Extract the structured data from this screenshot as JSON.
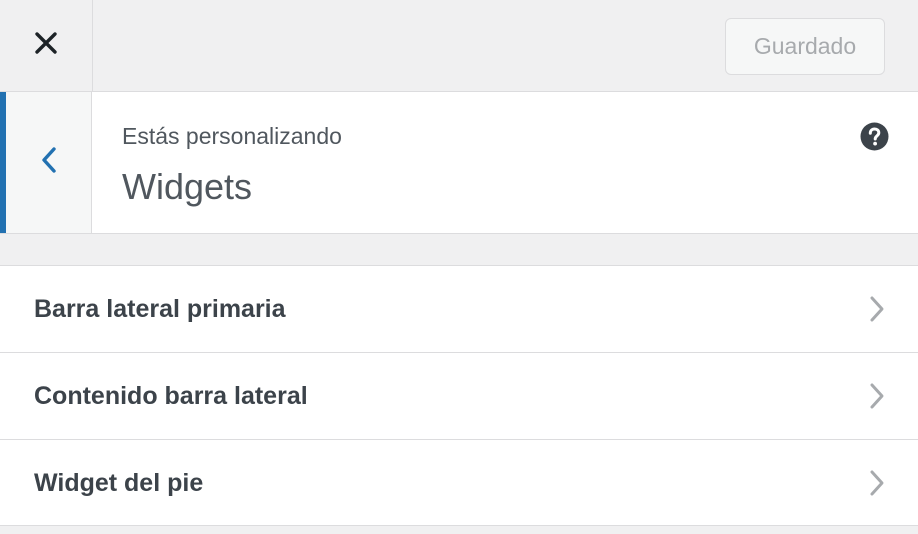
{
  "topbar": {
    "close_icon": "close-icon",
    "save_label": "Guardado"
  },
  "header": {
    "back_icon": "chevron-left-icon",
    "subtitle": "Estás personalizando",
    "title": "Widgets",
    "help_icon": "help-icon"
  },
  "sections": {
    "items": [
      {
        "label": "Barra lateral primaria",
        "icon": "chevron-right-icon"
      },
      {
        "label": "Contenido barra lateral",
        "icon": "chevron-right-icon"
      },
      {
        "label": "Widget del pie",
        "icon": "chevron-right-icon"
      }
    ]
  },
  "colors": {
    "accent": "#2271b1",
    "background": "#f0f0f1",
    "panel": "#ffffff",
    "text": "#50575e",
    "muted": "#a7aaad"
  }
}
